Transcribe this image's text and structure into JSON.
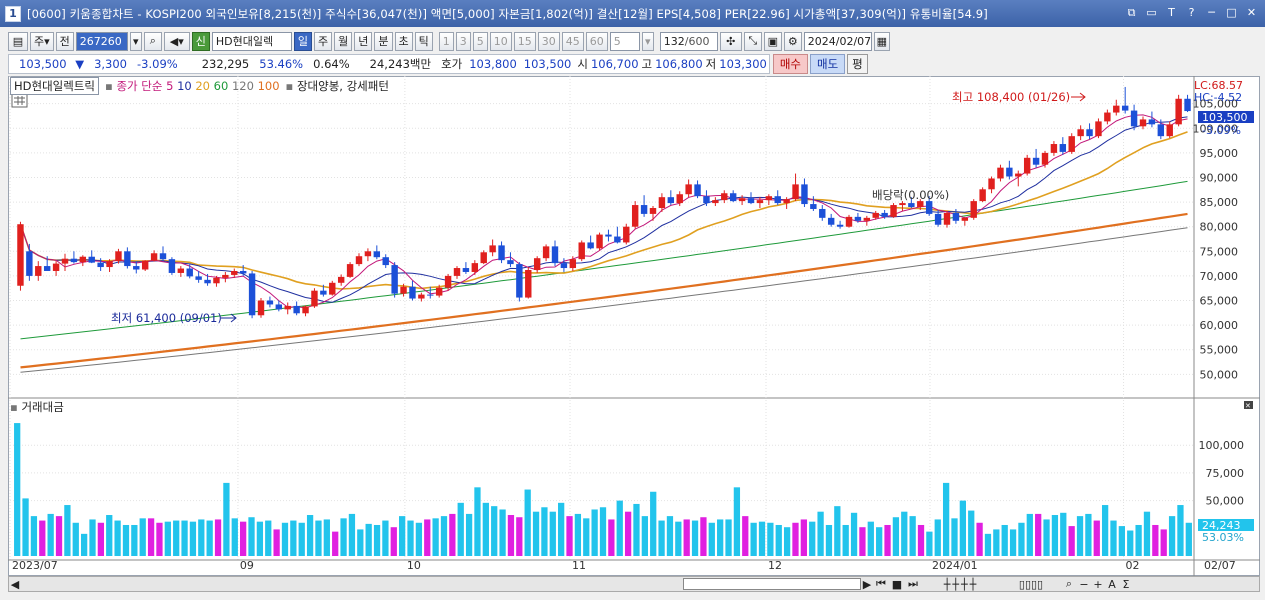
{
  "titlebar": {
    "badge": "1",
    "text": "[0600] 키움종합차트 - KOSPI200 외국인보유[8,215(천)] 주식수[36,047(천)] 액면[5,000] 자본금[1,802(억)] 결산[12월] EPS[4,508] PER[22.96] 시가총액[37,309(억)] 유통비율[54.9]",
    "buttons": [
      "⧉",
      "▭",
      "T",
      "?",
      "─",
      "□",
      "✕"
    ]
  },
  "toolbar": {
    "period": "주",
    "prev": "전",
    "code": "267260",
    "stock_badge": "신",
    "stock_name": "HD현대일렉",
    "tabs": [
      "일",
      "주",
      "월",
      "년",
      "분",
      "초",
      "틱"
    ],
    "active_tab": "일",
    "intervals": [
      "1",
      "3",
      "5",
      "10",
      "15",
      "30",
      "45",
      "60"
    ],
    "interval_value": "5",
    "count": "132",
    "count_total": "/600",
    "date": "2024/02/07"
  },
  "quote": {
    "price": "103,500",
    "change": "3,300",
    "change_pct": "-3.09%",
    "volume": "232,295",
    "vol_ratio": "53.46%",
    "turnover_pct": "0.64%",
    "amount": "24,243백만",
    "bid_label": "호가",
    "bid": "103,800",
    "ask": "103,500",
    "open_label": "시",
    "open": "106,700",
    "high_label": "고",
    "high": "106,800",
    "low_label": "저",
    "low": "103,300",
    "buy": "매수",
    "sell": "매도",
    "eval": "평"
  },
  "legend": {
    "name": "HD현대일렉트릭",
    "ma_label": "종가 단순",
    "ma_periods": [
      "5",
      "10",
      "20",
      "60",
      "120",
      "100"
    ],
    "pattern": "장대양봉, 강세패턴"
  },
  "annotations": {
    "high": "최고 108,400 (01/26)",
    "low": "최저 61,400 (09/01)",
    "dividend": "배당락(0.00%)",
    "lc": "LC:68.57",
    "hc": "HC:-4.52",
    "last_price_tag": "103,500",
    "last_pct_tag": "-3.09%",
    "vol_label": "거래대금",
    "vol_tag": "24,243",
    "vol_pct_tag": "53.03%"
  },
  "chart_data": {
    "type": "candlestick",
    "y_axis": [
      "105,000",
      "100,000",
      "95,000",
      "90,000",
      "85,000",
      "80,000",
      "75,000",
      "70,000",
      "65,000",
      "60,000",
      "55,000",
      "50,000"
    ],
    "ylim": [
      46000,
      109000
    ],
    "vol_axis": [
      "100,000",
      "75,000",
      "50,000"
    ],
    "x_labels": [
      "2023/07",
      "09",
      "10",
      "11",
      "12",
      "2024/01",
      "02",
      "02/07"
    ],
    "candles_ohlc": [
      [
        68000,
        81000,
        67000,
        80500
      ],
      [
        75000,
        76500,
        69000,
        70000
      ],
      [
        70000,
        73000,
        69000,
        72000
      ],
      [
        72000,
        74000,
        71500,
        71000
      ],
      [
        71000,
        73000,
        70000,
        72500
      ],
      [
        72500,
        74500,
        71000,
        73500
      ],
      [
        73500,
        75000,
        72500,
        72800
      ],
      [
        72800,
        74200,
        72000,
        73900
      ],
      [
        73900,
        75200,
        72600,
        72700
      ],
      [
        72700,
        73600,
        71000,
        71800
      ],
      [
        71800,
        73400,
        70800,
        73000
      ],
      [
        73000,
        75500,
        72500,
        75000
      ],
      [
        75000,
        75800,
        71500,
        72000
      ],
      [
        72000,
        73000,
        70500,
        71300
      ],
      [
        71300,
        73200,
        71000,
        73100
      ],
      [
        73100,
        75200,
        72900,
        74600
      ],
      [
        74600,
        76000,
        73000,
        73400
      ],
      [
        73400,
        73800,
        70200,
        70600
      ],
      [
        70600,
        72000,
        69800,
        71500
      ],
      [
        71500,
        72300,
        69500,
        69900
      ],
      [
        69900,
        71000,
        68600,
        69200
      ],
      [
        69200,
        70400,
        68000,
        68500
      ],
      [
        68500,
        70000,
        67800,
        69600
      ],
      [
        69600,
        70800,
        68700,
        70200
      ],
      [
        70200,
        71500,
        69600,
        71000
      ],
      [
        71000,
        72200,
        70000,
        70500
      ],
      [
        70500,
        71000,
        61400,
        62000
      ],
      [
        62000,
        65500,
        61500,
        65000
      ],
      [
        65000,
        65800,
        63600,
        64200
      ],
      [
        64200,
        65000,
        62800,
        63200
      ],
      [
        63200,
        64600,
        62200,
        63900
      ],
      [
        63900,
        64800,
        62000,
        62400
      ],
      [
        62400,
        64000,
        61800,
        63800
      ],
      [
        63800,
        67500,
        63500,
        67000
      ],
      [
        67000,
        68200,
        65800,
        66200
      ],
      [
        66200,
        69000,
        66000,
        68600
      ],
      [
        68600,
        70300,
        68000,
        69800
      ],
      [
        69800,
        72800,
        69600,
        72400
      ],
      [
        72400,
        74600,
        72000,
        74000
      ],
      [
        74000,
        75600,
        73000,
        75000
      ],
      [
        75000,
        76200,
        73400,
        73800
      ],
      [
        73800,
        74400,
        71600,
        72200
      ],
      [
        72200,
        72800,
        65600,
        66400
      ],
      [
        66400,
        68400,
        65800,
        67800
      ],
      [
        67800,
        69000,
        65000,
        65400
      ],
      [
        65400,
        66600,
        64800,
        66200
      ],
      [
        66200,
        67800,
        65400,
        66000
      ],
      [
        66000,
        68200,
        65600,
        67600
      ],
      [
        67600,
        70400,
        67000,
        70000
      ],
      [
        70000,
        72000,
        69400,
        71600
      ],
      [
        71600,
        72800,
        70400,
        70800
      ],
      [
        70800,
        73200,
        70200,
        72600
      ],
      [
        72600,
        75200,
        72400,
        74800
      ],
      [
        74800,
        77400,
        74000,
        76200
      ],
      [
        76200,
        77000,
        72600,
        73200
      ],
      [
        73200,
        74800,
        71800,
        72400
      ],
      [
        72400,
        72800,
        64800,
        65600
      ],
      [
        65600,
        71800,
        65400,
        71200
      ],
      [
        71200,
        74000,
        70600,
        73600
      ],
      [
        73600,
        76400,
        73000,
        76000
      ],
      [
        76000,
        77200,
        72000,
        72600
      ],
      [
        72600,
        73600,
        70800,
        71600
      ],
      [
        71600,
        74000,
        71000,
        73400
      ],
      [
        73400,
        77200,
        73000,
        76800
      ],
      [
        76800,
        78200,
        75400,
        75600
      ],
      [
        75600,
        78800,
        75200,
        78400
      ],
      [
        78400,
        79400,
        77000,
        78000
      ],
      [
        78000,
        80000,
        76600,
        76800
      ],
      [
        76800,
        80600,
        76400,
        80000
      ],
      [
        80000,
        85200,
        79600,
        84400
      ],
      [
        84400,
        86400,
        82000,
        82600
      ],
      [
        82600,
        84200,
        81200,
        83800
      ],
      [
        83800,
        86800,
        83000,
        86000
      ],
      [
        86000,
        87400,
        84400,
        84800
      ],
      [
        84800,
        87200,
        84200,
        86600
      ],
      [
        86600,
        89600,
        86000,
        88600
      ],
      [
        88600,
        89400,
        85800,
        86200
      ],
      [
        86200,
        87400,
        84200,
        84800
      ],
      [
        84800,
        86000,
        84200,
        85400
      ],
      [
        85400,
        87400,
        84800,
        86800
      ],
      [
        86800,
        87400,
        85000,
        85200
      ],
      [
        85200,
        86400,
        84400,
        85800
      ],
      [
        85800,
        87000,
        84600,
        84800
      ],
      [
        84800,
        86000,
        83800,
        85400
      ],
      [
        85400,
        86600,
        84400,
        86200
      ],
      [
        86200,
        87400,
        84400,
        84800
      ],
      [
        84800,
        86000,
        83600,
        85600
      ],
      [
        85600,
        90800,
        85200,
        88600
      ],
      [
        88600,
        89800,
        84000,
        84600
      ],
      [
        84600,
        86200,
        83200,
        83600
      ],
      [
        83600,
        84400,
        81200,
        81800
      ],
      [
        81800,
        82600,
        80000,
        80400
      ],
      [
        80400,
        81200,
        79600,
        80000
      ],
      [
        80000,
        82400,
        79800,
        82000
      ],
      [
        82000,
        82800,
        80800,
        81200
      ],
      [
        81200,
        82200,
        80200,
        81800
      ],
      [
        81800,
        83200,
        81400,
        82800
      ],
      [
        82800,
        83400,
        81600,
        82000
      ],
      [
        82000,
        84800,
        81800,
        84400
      ],
      [
        84400,
        85200,
        83200,
        84800
      ],
      [
        84800,
        86000,
        83800,
        84000
      ],
      [
        84000,
        85600,
        83400,
        85200
      ],
      [
        85200,
        86200,
        82200,
        82600
      ],
      [
        82600,
        83400,
        80000,
        80400
      ],
      [
        80400,
        83200,
        79800,
        82800
      ],
      [
        82800,
        83600,
        80600,
        81200
      ],
      [
        81200,
        82000,
        80200,
        81800
      ],
      [
        81800,
        85600,
        81400,
        85200
      ],
      [
        85200,
        88000,
        85000,
        87600
      ],
      [
        87600,
        90200,
        86800,
        89800
      ],
      [
        89800,
        92600,
        89200,
        92000
      ],
      [
        92000,
        93400,
        89600,
        90200
      ],
      [
        90200,
        91400,
        88200,
        90800
      ],
      [
        90800,
        94600,
        90400,
        94000
      ],
      [
        94000,
        95800,
        92000,
        92600
      ],
      [
        92600,
        95400,
        92000,
        95000
      ],
      [
        95000,
        97400,
        94400,
        96800
      ],
      [
        96800,
        98200,
        94600,
        95200
      ],
      [
        95200,
        99000,
        94800,
        98400
      ],
      [
        98400,
        100600,
        97600,
        99800
      ],
      [
        99800,
        101000,
        97800,
        98400
      ],
      [
        98400,
        102000,
        98000,
        101400
      ],
      [
        101400,
        103800,
        100800,
        103200
      ],
      [
        103200,
        105800,
        102600,
        104600
      ],
      [
        104600,
        108400,
        103000,
        103600
      ],
      [
        103600,
        104800,
        99600,
        100400
      ],
      [
        100400,
        102400,
        99800,
        101800
      ],
      [
        101800,
        103400,
        100200,
        100800
      ],
      [
        100800,
        101800,
        97800,
        98400
      ],
      [
        98400,
        101400,
        98000,
        100800
      ],
      [
        100800,
        106800,
        100400,
        106000
      ],
      [
        106000,
        106800,
        103300,
        103500
      ]
    ],
    "volumes": [
      120000,
      52000,
      36000,
      32000,
      38000,
      36000,
      46000,
      30000,
      20000,
      33000,
      30000,
      37000,
      32000,
      28000,
      28000,
      34000,
      34000,
      30000,
      31000,
      32000,
      32000,
      31000,
      33000,
      32000,
      33000,
      66000,
      34000,
      31000,
      35000,
      31000,
      32000,
      24000,
      30000,
      32000,
      30000,
      37000,
      32000,
      33000,
      22000,
      34000,
      38000,
      24000,
      29000,
      28000,
      32000,
      26000,
      36000,
      32000,
      30000,
      33000,
      34000,
      36000,
      38000,
      48000,
      38000,
      62000,
      48000,
      45000,
      42000,
      37000,
      35000,
      60000,
      40000,
      44000,
      40000,
      48000,
      36000,
      38000,
      34000,
      42000,
      44000,
      33000,
      50000,
      40000,
      47000,
      36000,
      58000,
      32000,
      36000,
      31000,
      33000,
      32000,
      35000,
      30000,
      33000,
      33000,
      62000,
      36000,
      30000,
      31000,
      30000,
      28000,
      26000,
      30000,
      33000,
      31000,
      40000,
      28000,
      45000,
      28000,
      39000,
      26000,
      31000,
      26000,
      28000,
      35000,
      40000,
      36000,
      28000,
      22000,
      33000,
      66000,
      34000,
      50000,
      41000,
      30000,
      20000,
      24000,
      28000,
      24000,
      30000,
      38000,
      38000,
      33000,
      37000,
      39000,
      27000,
      36000,
      38000,
      32000,
      46000,
      32000,
      27000,
      23000,
      28000,
      40000,
      28000,
      24000,
      36000,
      46000,
      30000
    ]
  }
}
